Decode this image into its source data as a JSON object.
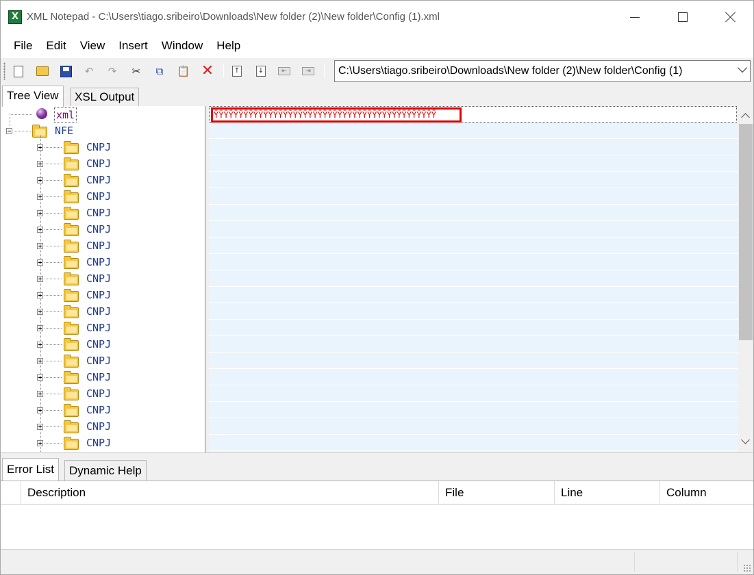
{
  "window": {
    "title": "XML Notepad - C:\\Users\\tiago.sribeiro\\Downloads\\New folder (2)\\New folder\\Config (1).xml",
    "app_icon_letter": "X"
  },
  "menu": [
    "File",
    "Edit",
    "View",
    "Insert",
    "Window",
    "Help"
  ],
  "toolbar": {
    "icons": [
      "new-file-icon",
      "open-folder-icon",
      "save-icon",
      "undo-icon",
      "redo-icon",
      "cut-icon",
      "copy-icon",
      "paste-icon",
      "delete-icon",
      "nudge-up-icon",
      "nudge-down-icon",
      "nudge-left-icon",
      "nudge-right-icon"
    ],
    "location": "C:\\Users\\tiago.sribeiro\\Downloads\\New folder (2)\\New folder\\Config (1)"
  },
  "top_tabs": [
    "Tree View",
    "XSL Output"
  ],
  "tree": {
    "pi_label": "xml",
    "root_label": "NFE",
    "child_label": "CNPJ",
    "child_count": 20
  },
  "node_pane": {
    "selected_value": "ȲȲȲȲȲȲȲȲȲȲȲȲȲȲȲȲȲȲȲȲȲȲȲȲȲȲȲȲȲȲȲȲȲȲȲȲȲȲȲȲȲȲȲȲȲ"
  },
  "bottom_tabs": [
    "Error List",
    "Dynamic Help"
  ],
  "error_columns": [
    "Description",
    "File",
    "Line",
    "Column"
  ]
}
